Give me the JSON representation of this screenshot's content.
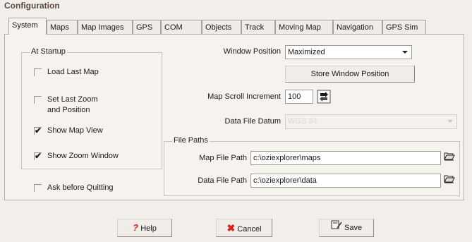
{
  "window": {
    "title": "Configuration"
  },
  "tabs": [
    "System",
    "Maps",
    "Map Images",
    "GPS",
    "COM",
    "Objects",
    "Track",
    "Moving Map",
    "Navigation",
    "GPS Sim"
  ],
  "startup": {
    "group_label": "At Startup",
    "load_last_map": {
      "label": "Load Last Map",
      "checked": false
    },
    "set_last_zoom_line1": "Set Last Zoom",
    "set_last_zoom_line2": "and Position",
    "set_last_zoom_checked": false,
    "show_map_view": {
      "label": "Show Map View",
      "checked": true
    },
    "show_zoom_window": {
      "label": "Show Zoom Window",
      "checked": true
    }
  },
  "ask_before_quitting": {
    "label": "Ask before Quitting",
    "checked": false
  },
  "window_position": {
    "label": "Window Position",
    "value": "Maximized"
  },
  "store_window_position_label": "Store Window Position",
  "map_scroll_increment": {
    "label": "Map Scroll Increment",
    "value": "100"
  },
  "data_file_datum": {
    "label": "Data File Datum",
    "value": "WGS 84"
  },
  "file_paths": {
    "group_label": "File Paths",
    "map_file_path": {
      "label": "Map File Path",
      "value": "c:\\oziexplorer\\maps"
    },
    "data_file_path": {
      "label": "Data File Path",
      "value": "c:\\oziexplorer\\data"
    }
  },
  "buttons": {
    "help": "Help",
    "cancel": "Cancel",
    "save": "Save"
  },
  "icons": {
    "help": "question-mark-icon",
    "cancel": "red-x-icon",
    "save": "floppy-save-icon",
    "open": "folder-open-icon",
    "spin": "spin-arrows-icon",
    "dropdown": "chevron-down-icon"
  },
  "colors": {
    "cancel_x": "#e0201a",
    "help_mark": "#e0201a",
    "window_bg": "#f2eeea"
  }
}
